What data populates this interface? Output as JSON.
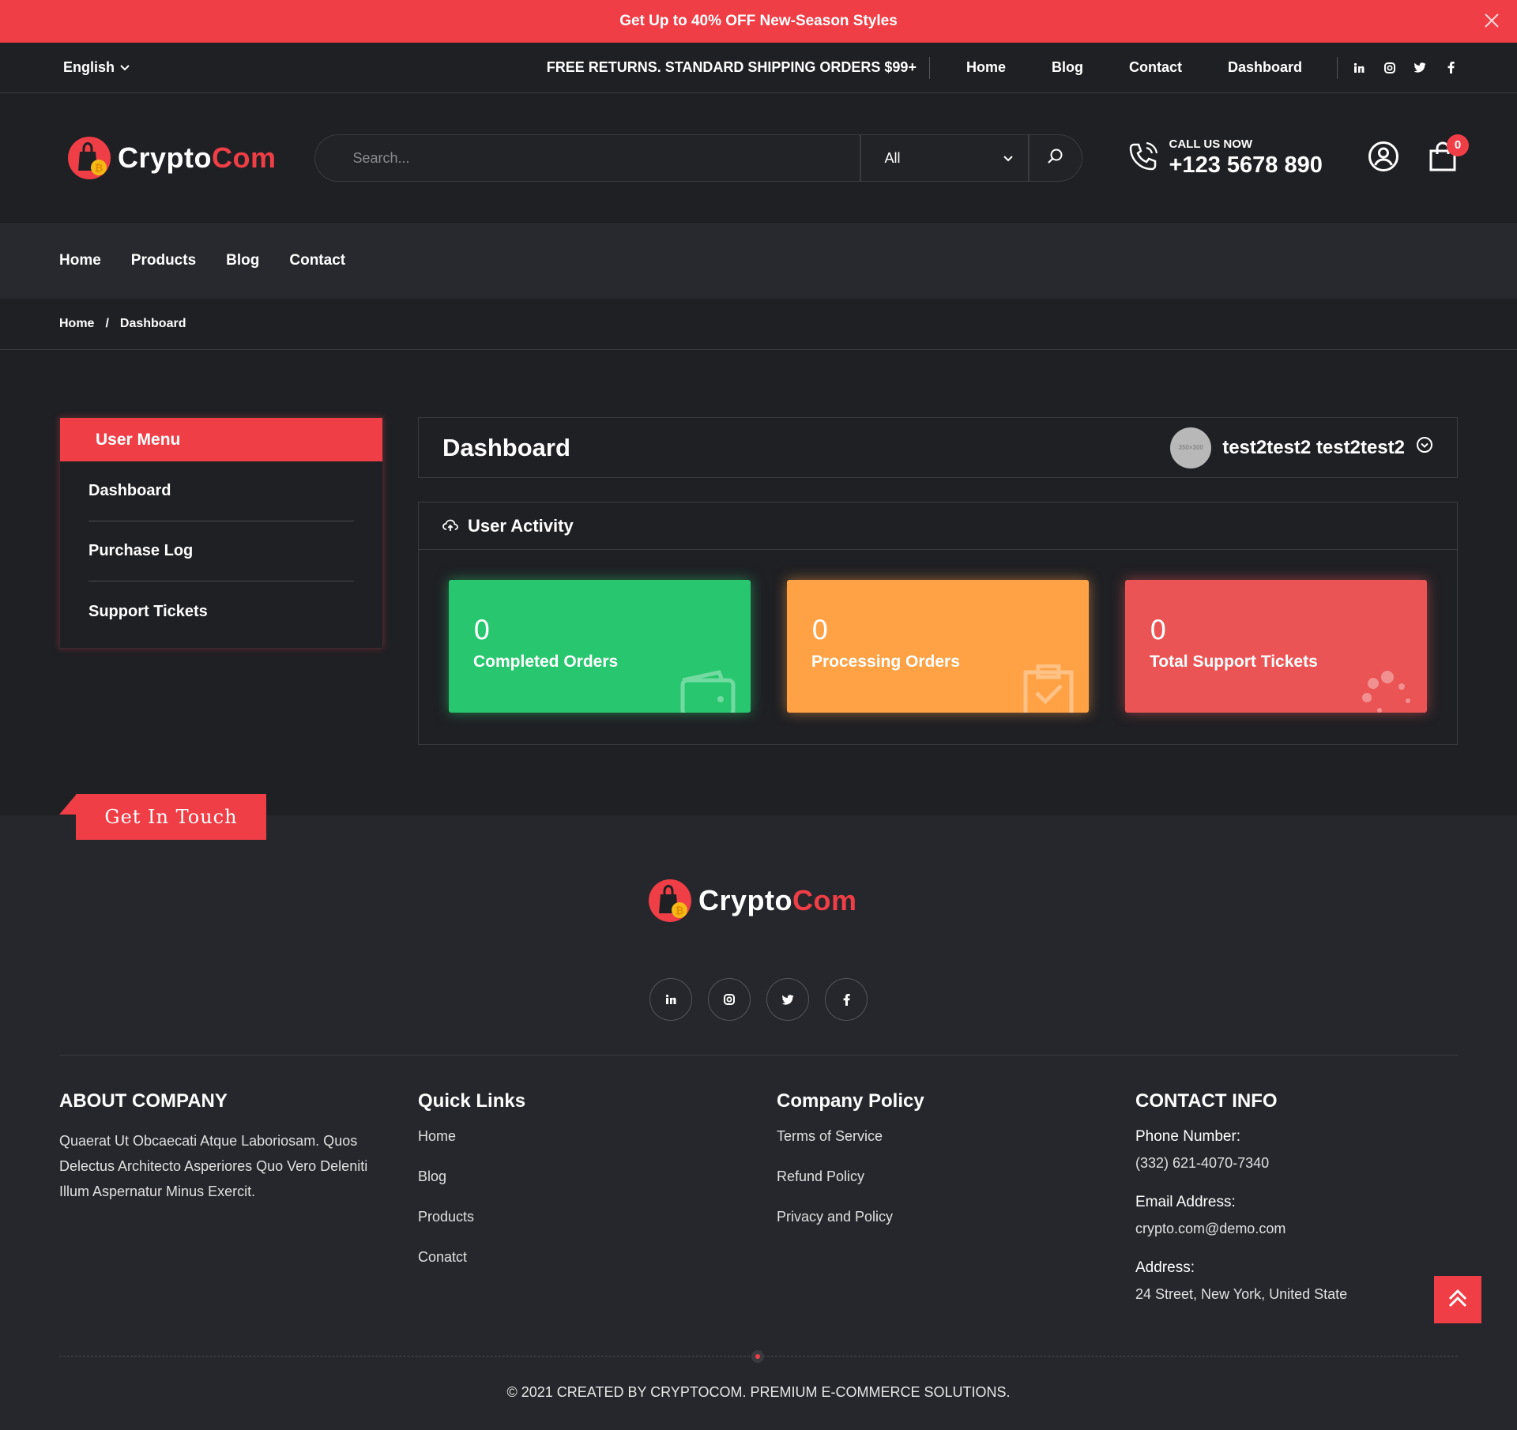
{
  "promo": {
    "text": "Get Up to 40% OFF New-Season Styles"
  },
  "topbar": {
    "language": "English",
    "shipping": "FREE RETURNS. STANDARD SHIPPING ORDERS $99+",
    "nav": [
      "Home",
      "Blog",
      "Contact",
      "Dashboard"
    ],
    "social": [
      "in",
      "ig",
      "tw",
      "fb"
    ]
  },
  "header": {
    "logo_main": "Crypto",
    "logo_accent": "Com",
    "search_placeholder": "Search...",
    "category": "All",
    "call_label": "CALL US NOW",
    "phone": "+123 5678 890",
    "cart_count": "0"
  },
  "mainnav": [
    "Home",
    "Products",
    "Blog",
    "Contact"
  ],
  "breadcrumb": {
    "home": "Home",
    "sep": "/",
    "current": "Dashboard"
  },
  "user_menu": {
    "title": "User Menu",
    "items": [
      "Dashboard",
      "Purchase Log",
      "Support Tickets"
    ]
  },
  "dashboard": {
    "title": "Dashboard",
    "avatar_text": "350×300",
    "username": "test2test2 test2test2",
    "activity_title": "User Activity",
    "cards": [
      {
        "value": "0",
        "label": "Completed Orders",
        "color": "#28c76f"
      },
      {
        "value": "0",
        "label": "Processing Orders",
        "color": "#ffa145"
      },
      {
        "value": "0",
        "label": "Total Support Tickets",
        "color": "#ea5455"
      }
    ]
  },
  "footer": {
    "get_in_touch": "Get In Touch",
    "about_title": "ABOUT COMPANY",
    "about_text": "Quaerat Ut Obcaecati Atque Laboriosam. Quos Delectus Architecto Asperiores Quo Vero Deleniti Illum Aspernatur Minus Exercit.",
    "quick_title": "Quick Links",
    "quick_links": [
      "Home",
      "Blog",
      "Products",
      "Conatct"
    ],
    "policy_title": "Company Policy",
    "policy_links": [
      "Terms of Service",
      "Refund Policy",
      "Privacy and Policy"
    ],
    "contact_title": "CONTACT INFO",
    "phone_label": "Phone Number:",
    "phone_value": "(332) 621-4070-7340",
    "email_label": "Email Address:",
    "email_value": "crypto.com@demo.com",
    "address_label": "Address:",
    "address_value": "24 Street, New York, United State",
    "copyright": "© 2021 CREATED BY CRYPTOCOM. PREMIUM E-COMMERCE SOLUTIONS."
  },
  "colors": {
    "accent": "#ef3e46",
    "background": "#1f2024",
    "footer": "#25272c"
  }
}
